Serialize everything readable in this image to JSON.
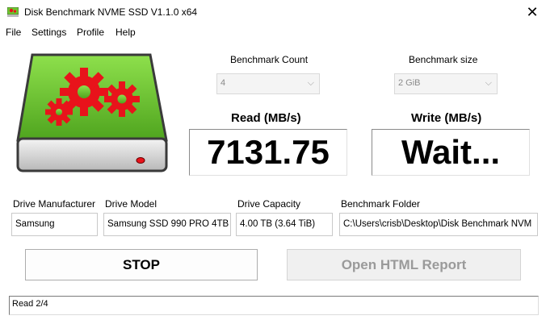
{
  "window": {
    "title": "Disk Benchmark NVME SSD V1.1.0 x64",
    "close_glyph": "✕"
  },
  "menu": [
    "File",
    "Settings",
    "Profile",
    "Help"
  ],
  "benchmark_count": {
    "label": "Benchmark Count",
    "value": "4"
  },
  "benchmark_size": {
    "label": "Benchmark size",
    "value": "2 GiB"
  },
  "read": {
    "label": "Read (MB/s)",
    "value": "7131.75"
  },
  "write": {
    "label": "Write (MB/s)",
    "value": "Wait..."
  },
  "drive": {
    "manufacturer_label": "Drive Manufacturer",
    "manufacturer": "Samsung",
    "model_label": "Drive Model",
    "model": "Samsung SSD 990 PRO 4TB",
    "capacity_label": "Drive Capacity",
    "capacity": "4.00 TB (3.64 TiB)",
    "folder_label": "Benchmark Folder",
    "folder": "C:\\Users\\crisb\\Desktop\\Disk Benchmark NVM"
  },
  "buttons": {
    "stop": "STOP",
    "report": "Open HTML Report"
  },
  "status": "Read 2/4",
  "colors": {
    "drive_green": "#6dc72f",
    "gear_red": "#e8131b",
    "accent": "#000000"
  },
  "icons": {
    "app": "drive-gears-icon",
    "chevron": "chevron-down-icon"
  }
}
